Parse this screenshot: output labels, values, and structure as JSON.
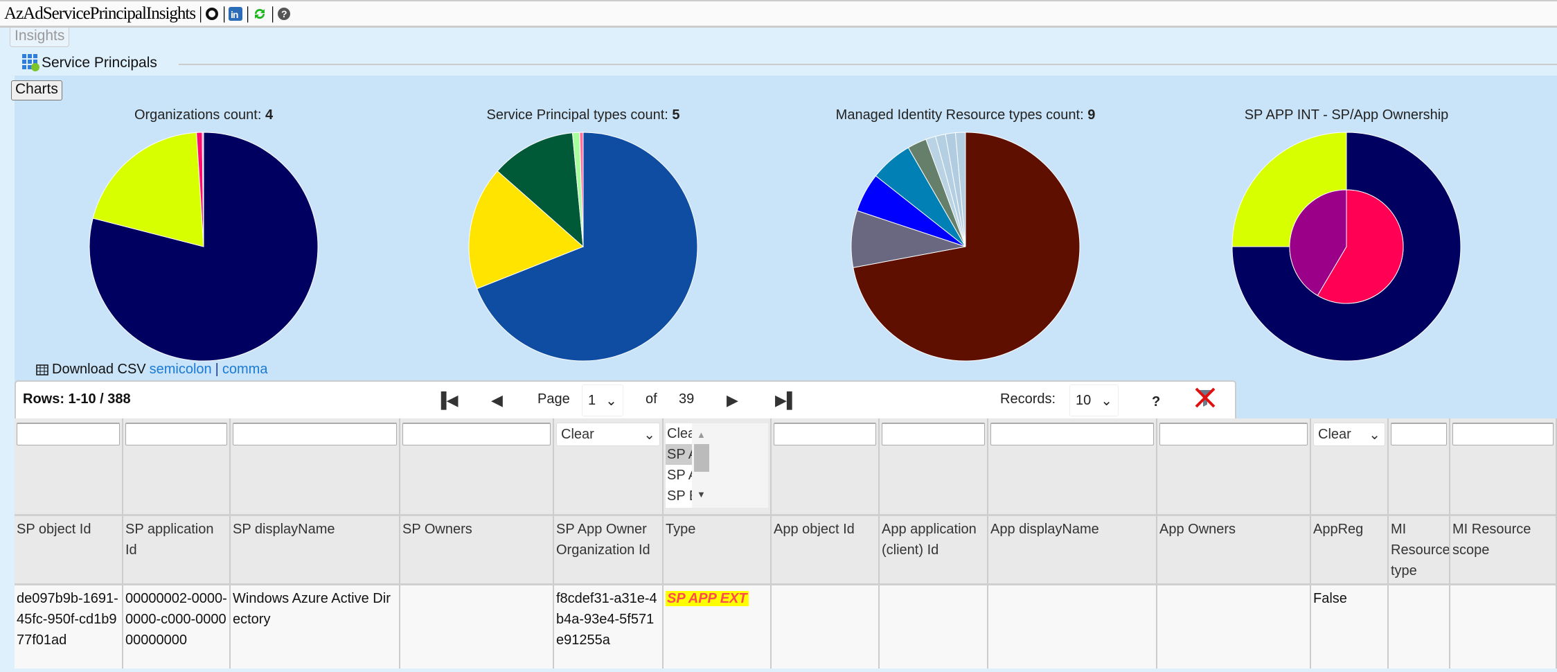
{
  "app": {
    "title": "AzAdServicePrincipalInsights",
    "icons": [
      "github-icon",
      "linkedin-icon",
      "refresh-icon",
      "help-icon"
    ]
  },
  "tabs": {
    "insights": "Insights"
  },
  "section": {
    "title": "Service Principals",
    "icon": "service-principal-icon"
  },
  "charts_button": "Charts",
  "chart_data": [
    {
      "type": "pie",
      "title": "Organizations count:",
      "count": "4",
      "values": [
        0.79,
        0.2,
        0.008,
        0.002
      ],
      "colors": [
        "#000060",
        "#d8ff00",
        "#ff0a6e",
        "#ff9ec4"
      ]
    },
    {
      "type": "pie",
      "title": "Service Principal types count:",
      "count": "5",
      "values": [
        0.69,
        0.175,
        0.12,
        0.01,
        0.005
      ],
      "colors": [
        "#0e4da2",
        "#ffe400",
        "#005a38",
        "#a6ff9c",
        "#ff6fa0"
      ]
    },
    {
      "type": "pie",
      "title": "Managed Identity Resource types count:",
      "count": "9",
      "values": [
        0.717,
        0.08,
        0.055,
        0.06,
        0.027,
        0.014,
        0.014,
        0.014,
        0.014
      ],
      "colors": [
        "#5e0f00",
        "#6a6880",
        "#0000ff",
        "#0080b5",
        "#667f6a",
        "#b9d3e4",
        "#b5cfe2",
        "#b1cbe0",
        "#b5cfe2"
      ]
    },
    {
      "type": "donut",
      "title": "SP APP INT - SP/App Ownership",
      "outer": {
        "values": [
          0.75,
          0.25
        ],
        "colors": [
          "#000060",
          "#d8ff00"
        ]
      },
      "inner": {
        "values": [
          0.585,
          0.415
        ],
        "colors": [
          "#ff0055",
          "#9a0088"
        ]
      }
    }
  ],
  "download": {
    "label": "Download CSV",
    "semicolon": "semicolon",
    "separator": "|",
    "comma": "comma"
  },
  "pager": {
    "rows": "Rows: 1-10 / 388",
    "page_label": "Page",
    "page": "1",
    "of_label": "of",
    "pages": "39",
    "records_label": "Records:",
    "records": "10",
    "help": "?"
  },
  "filters": {
    "type_select": "Clear",
    "type_list": [
      "Clear",
      "SP APP EXT",
      "SP APP INT",
      "SP EXT"
    ],
    "appreg_select": "Clear"
  },
  "columns": [
    "SP object Id",
    "SP application Id",
    "SP displayName",
    "SP Owners",
    "SP App Owner Organization Id",
    "Type",
    "App object Id",
    "App application (client) Id",
    "App displayName",
    "App Owners",
    "AppReg",
    "MI Resource type",
    "MI Resource scope"
  ],
  "rows": [
    [
      "de097b9b-1691-45fc-950f-cd1b977f01ad",
      "00000002-0000-0000-c000-000000000000",
      "Windows Azure Active Directory",
      "",
      "f8cdef31-a31e-4b4a-93e4-5f571e91255a",
      "SP APP EXT",
      "",
      "",
      "",
      "",
      "False",
      "",
      ""
    ]
  ]
}
